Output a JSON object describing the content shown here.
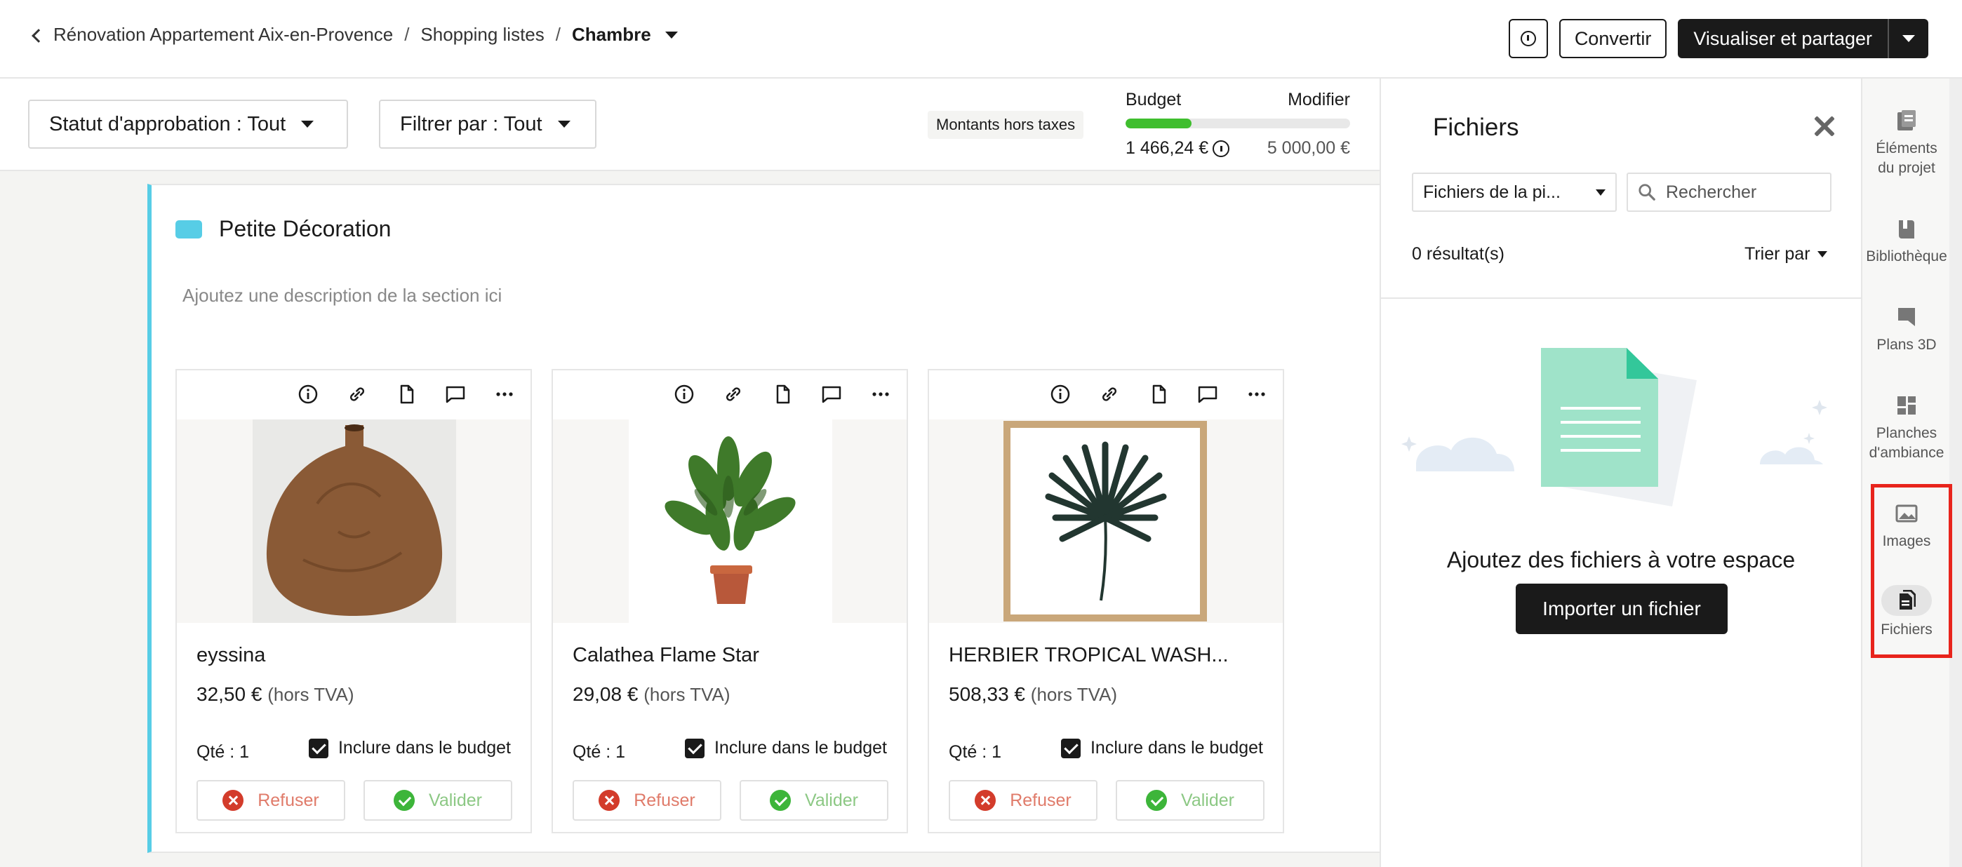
{
  "breadcrumb": {
    "project": "Rénovation Appartement Aix-en-Provence",
    "separator": "/",
    "list": "Shopping listes",
    "room": "Chambre"
  },
  "toolbar": {
    "convert_label": "Convertir",
    "share_label": "Visualiser et partager"
  },
  "filters": {
    "approval": "Statut d'approbation : Tout",
    "filter_by": "Filtrer par : Tout",
    "tax_badge": "Montants hors taxes"
  },
  "budget": {
    "label": "Budget",
    "edit_label": "Modifier",
    "spent": "1 466,24 €",
    "total": "5 000,00 €",
    "progress_fraction": 0.293
  },
  "section": {
    "title": "Petite Décoration",
    "description_placeholder": "Ajoutez une description de la section ici",
    "color": "#57cde6"
  },
  "products": [
    {
      "name": "eyssina",
      "price": "32,50 €",
      "tax_note": "(hors TVA)",
      "qty": "Qté : 1",
      "budget_label": "Inclure dans le budget",
      "refuse_label": "Refuser",
      "validate_label": "Valider"
    },
    {
      "name": "Calathea Flame Star",
      "price": "29,08 €",
      "tax_note": "(hors TVA)",
      "qty": "Qté : 1",
      "budget_label": "Inclure dans le budget",
      "refuse_label": "Refuser",
      "validate_label": "Valider"
    },
    {
      "name": "HERBIER TROPICAL WASH...",
      "price": "508,33 €",
      "tax_note": "(hors TVA)",
      "qty": "Qté : 1",
      "budget_label": "Inclure dans le budget",
      "refuse_label": "Refuser",
      "validate_label": "Valider"
    }
  ],
  "files_panel": {
    "title": "Fichiers",
    "source_select": "Fichiers de la pi...",
    "search_placeholder": "Rechercher",
    "result_count": "0 résultat(s)",
    "sort_label": "Trier par",
    "empty_title": "Ajoutez des fichiers à votre espace",
    "import_label": "Importer un fichier"
  },
  "rail": {
    "items": [
      {
        "label_line1": "Éléments",
        "label_line2": "du projet",
        "icon": "project-items-icon"
      },
      {
        "label_line1": "Bibliothèque",
        "label_line2": "",
        "icon": "library-icon"
      },
      {
        "label_line1": "Plans 3D",
        "label_line2": "",
        "icon": "plans-3d-icon"
      },
      {
        "label_line1": "Planches",
        "label_line2": "d'ambiance",
        "icon": "moodboard-icon"
      },
      {
        "label_line1": "Images",
        "label_line2": "",
        "icon": "images-icon"
      },
      {
        "label_line1": "Fichiers",
        "label_line2": "",
        "icon": "files-icon"
      }
    ]
  },
  "colors": {
    "accent_dark": "#1a1a1a",
    "budget_green": "#3fbe2e",
    "refuse_red": "#d33c2b",
    "validate_green": "#3db53a",
    "highlight_red": "#e8241c"
  }
}
